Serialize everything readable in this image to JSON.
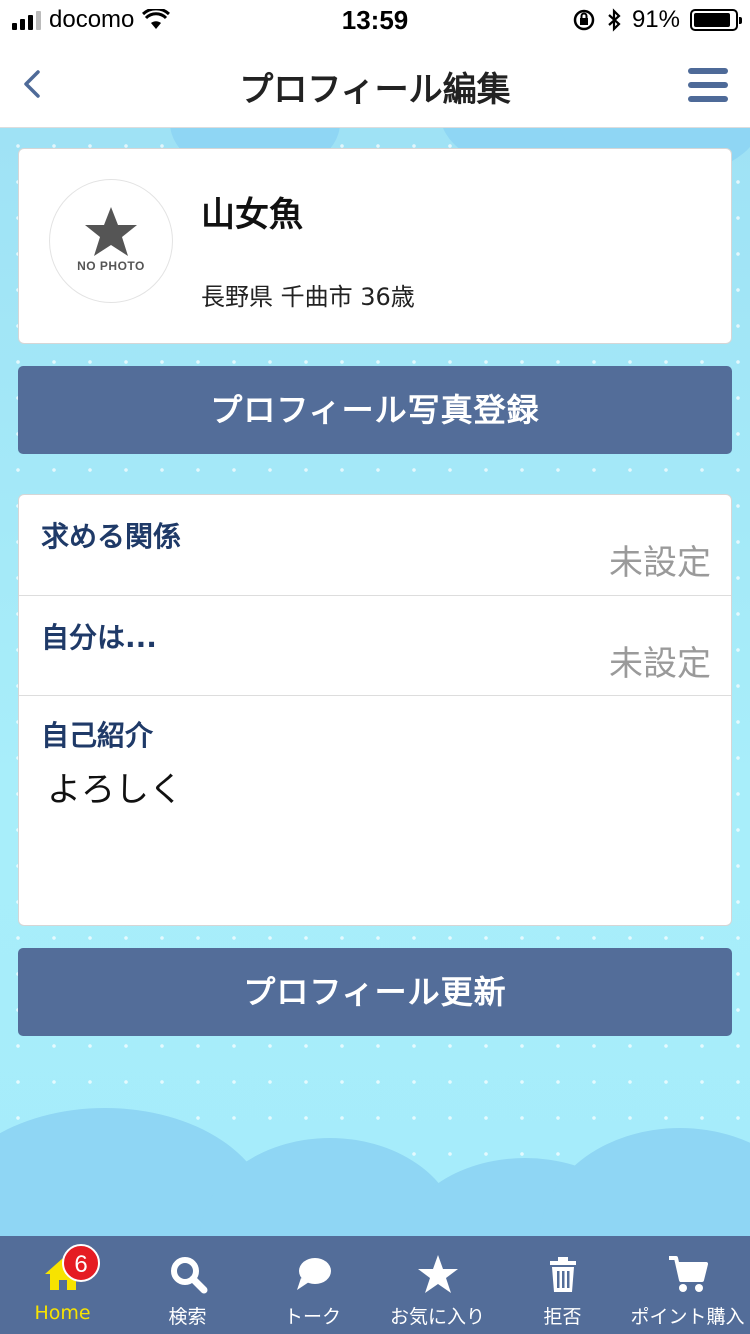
{
  "status_bar": {
    "carrier": "docomo",
    "time": "13:59",
    "battery": "91%",
    "battery_level": 0.91
  },
  "nav": {
    "title": "プロフィール編集",
    "back_icon": "chevron-left-icon",
    "menu_icon": "hamburger-menu-icon"
  },
  "profile": {
    "photo_placeholder": "NO PHOTO",
    "name": "山女魚",
    "location": "長野県 千曲市 36歳"
  },
  "buttons": {
    "photo_register": "プロフィール写真登録",
    "update": "プロフィール更新"
  },
  "fields": {
    "relationship": {
      "label": "求める関係",
      "value": "未設定"
    },
    "self": {
      "label": "自分は...",
      "value": "未設定"
    },
    "intro": {
      "label": "自己紹介",
      "value": "よろしく"
    }
  },
  "tabs": [
    {
      "label": "Home",
      "icon": "home-icon",
      "badge": "6",
      "active": true
    },
    {
      "label": "検索",
      "icon": "search-icon"
    },
    {
      "label": "トーク",
      "icon": "chat-bubble-icon"
    },
    {
      "label": "お気に入り",
      "icon": "star-icon"
    },
    {
      "label": "拒否",
      "icon": "trash-icon"
    },
    {
      "label": "ポイント購入",
      "icon": "cart-icon"
    }
  ],
  "colors": {
    "accent": "#536d99",
    "label_text": "#1f3a68",
    "active_tab": "#f7e300",
    "badge": "#e51c23",
    "background": "#a6ecfb"
  }
}
